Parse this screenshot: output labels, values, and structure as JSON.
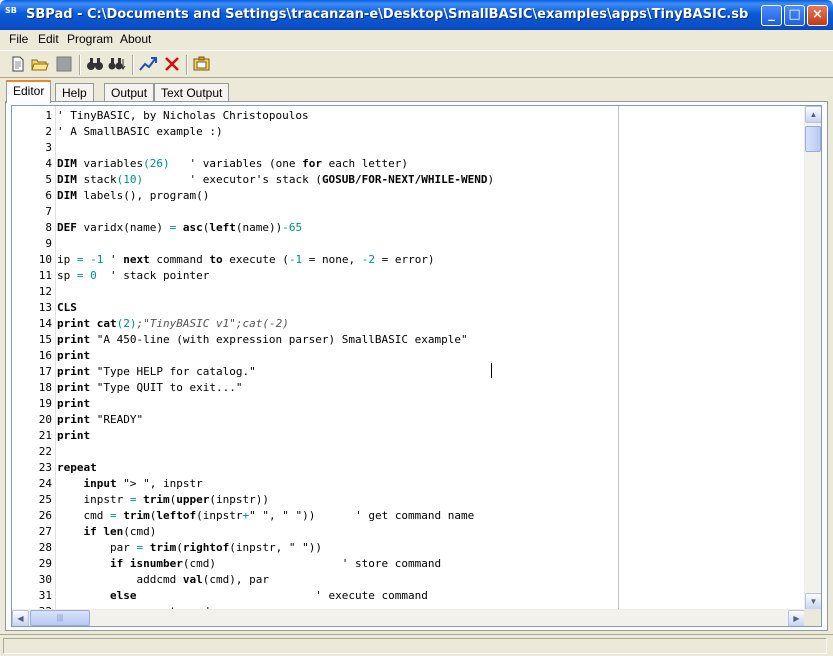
{
  "window": {
    "icon_text": "SB",
    "title": "SBPad - C:\\Documents and Settings\\tracanzan-e\\Desktop\\SmallBASIC\\examples\\apps\\TinyBASIC.sb",
    "minimize_glyph": "_",
    "maximize_glyph": "□",
    "close_glyph": "×"
  },
  "menu": [
    "File",
    "Edit",
    "Program",
    "About"
  ],
  "toolbar": {
    "icons": [
      "new-file-icon",
      "open-folder-icon",
      "save-icon",
      "find-icon",
      "find-next-icon",
      "run-icon",
      "stop-icon",
      "output-window-icon"
    ]
  },
  "tabs": [
    "Editor",
    "Help",
    "Output",
    "Text Output"
  ],
  "editor": {
    "lines": [
      {
        "n": "1",
        "seg": [
          [
            "cm",
            "' TinyBASIC, by Nicholas Christopoulos"
          ]
        ]
      },
      {
        "n": "2",
        "seg": [
          [
            "cm",
            "' A SmallBASIC example :)"
          ]
        ]
      },
      {
        "n": "3",
        "seg": []
      },
      {
        "n": "4",
        "seg": [
          [
            "kw",
            "DIM"
          ],
          [
            "",
            " variables"
          ],
          [
            "num",
            "(26)"
          ],
          [
            "",
            "   "
          ],
          [
            "cm",
            "' variables (one "
          ],
          [
            "kw",
            "for"
          ],
          [
            "cm",
            " each letter)"
          ]
        ]
      },
      {
        "n": "5",
        "seg": [
          [
            "kw",
            "DIM"
          ],
          [
            "",
            " stack"
          ],
          [
            "num",
            "(10)"
          ],
          [
            "",
            "       "
          ],
          [
            "cm",
            "' executor's stack ("
          ],
          [
            "kw",
            "GOSUB/FOR-NEXT/WHILE-WEND"
          ],
          [
            "cm",
            ")"
          ]
        ]
      },
      {
        "n": "6",
        "seg": [
          [
            "kw",
            "DIM"
          ],
          [
            "",
            " labels(), program()"
          ]
        ]
      },
      {
        "n": "7",
        "seg": []
      },
      {
        "n": "8",
        "seg": [
          [
            "kw",
            "DEF"
          ],
          [
            "",
            " varidx(name) "
          ],
          [
            "op",
            "="
          ],
          [
            "",
            " "
          ],
          [
            "kw",
            "asc"
          ],
          [
            "",
            "("
          ],
          [
            "kw",
            "left"
          ],
          [
            "",
            "(name))"
          ],
          [
            "num",
            "-65"
          ]
        ]
      },
      {
        "n": "9",
        "seg": []
      },
      {
        "n": "10",
        "seg": [
          [
            "",
            "ip "
          ],
          [
            "op",
            "="
          ],
          [
            "",
            " "
          ],
          [
            "num",
            "-1"
          ],
          [
            "",
            " "
          ],
          [
            "cm",
            "' "
          ],
          [
            "kw",
            "next"
          ],
          [
            "cm",
            " command "
          ],
          [
            "kw",
            "to"
          ],
          [
            "cm",
            " execute ("
          ],
          [
            "num",
            "-1"
          ],
          [
            "cm",
            " = none, "
          ],
          [
            "num",
            "-2"
          ],
          [
            "cm",
            " = error)"
          ]
        ]
      },
      {
        "n": "11",
        "seg": [
          [
            "",
            "sp "
          ],
          [
            "op",
            "="
          ],
          [
            "",
            " "
          ],
          [
            "num",
            "0"
          ],
          [
            "",
            "  "
          ],
          [
            "cm",
            "' stack pointer"
          ]
        ]
      },
      {
        "n": "12",
        "seg": []
      },
      {
        "n": "13",
        "seg": [
          [
            "kw",
            "CLS"
          ]
        ]
      },
      {
        "n": "14",
        "seg": [
          [
            "kw",
            "print"
          ],
          [
            "",
            " "
          ],
          [
            "kw",
            "cat"
          ],
          [
            "num",
            "(2)"
          ],
          [
            "it",
            ";\"TinyBASIC v1\";cat(-2)"
          ]
        ]
      },
      {
        "n": "15",
        "seg": [
          [
            "kw",
            "print"
          ],
          [
            "str",
            " \"A 450-line (with expression parser) SmallBASIC example\""
          ]
        ]
      },
      {
        "n": "16",
        "seg": [
          [
            "kw",
            "print"
          ]
        ]
      },
      {
        "n": "17",
        "seg": [
          [
            "kw",
            "print"
          ],
          [
            "str",
            " \"Type HELP for catalog.\""
          ]
        ]
      },
      {
        "n": "18",
        "seg": [
          [
            "kw",
            "print"
          ],
          [
            "str",
            " \"Type QUIT to exit...\""
          ]
        ]
      },
      {
        "n": "19",
        "seg": [
          [
            "kw",
            "print"
          ]
        ]
      },
      {
        "n": "20",
        "seg": [
          [
            "kw",
            "print"
          ],
          [
            "str",
            " \"READY\""
          ]
        ]
      },
      {
        "n": "21",
        "seg": [
          [
            "kw",
            "print"
          ]
        ]
      },
      {
        "n": "22",
        "seg": []
      },
      {
        "n": "23",
        "seg": [
          [
            "kw",
            "repeat"
          ]
        ]
      },
      {
        "n": "24",
        "seg": [
          [
            "",
            "    "
          ],
          [
            "kw",
            "input"
          ],
          [
            "str",
            " \"> \""
          ],
          [
            "",
            ", inpstr"
          ]
        ]
      },
      {
        "n": "25",
        "seg": [
          [
            "",
            "    inpstr "
          ],
          [
            "op",
            "="
          ],
          [
            "",
            " "
          ],
          [
            "kw",
            "trim"
          ],
          [
            "",
            "("
          ],
          [
            "kw",
            "upper"
          ],
          [
            "",
            "(inpstr))"
          ]
        ]
      },
      {
        "n": "26",
        "seg": [
          [
            "",
            "    cmd "
          ],
          [
            "op",
            "="
          ],
          [
            "",
            " "
          ],
          [
            "kw",
            "trim"
          ],
          [
            "",
            "("
          ],
          [
            "kw",
            "leftof"
          ],
          [
            "",
            "(inpstr"
          ],
          [
            "op",
            "+"
          ],
          [
            "str",
            "\" \""
          ],
          [
            "",
            ", "
          ],
          [
            "str",
            "\" \""
          ],
          [
            "",
            "))      "
          ],
          [
            "cm",
            "' get command name"
          ]
        ]
      },
      {
        "n": "27",
        "seg": [
          [
            "",
            "    "
          ],
          [
            "kw",
            "if"
          ],
          [
            "",
            " "
          ],
          [
            "kw",
            "len"
          ],
          [
            "",
            "(cmd)"
          ]
        ]
      },
      {
        "n": "28",
        "seg": [
          [
            "",
            "        par "
          ],
          [
            "op",
            "="
          ],
          [
            "",
            " "
          ],
          [
            "kw",
            "trim"
          ],
          [
            "",
            "("
          ],
          [
            "kw",
            "rightof"
          ],
          [
            "",
            "(inpstr, "
          ],
          [
            "str",
            "\" \""
          ],
          [
            "",
            "))"
          ]
        ]
      },
      {
        "n": "29",
        "seg": [
          [
            "",
            "        "
          ],
          [
            "kw",
            "if"
          ],
          [
            "",
            " "
          ],
          [
            "kw",
            "isnumber"
          ],
          [
            "",
            "(cmd)                   "
          ],
          [
            "cm",
            "' store command"
          ]
        ]
      },
      {
        "n": "30",
        "seg": [
          [
            "",
            "            addcmd "
          ],
          [
            "kw",
            "val"
          ],
          [
            "",
            "(cmd), par"
          ]
        ]
      },
      {
        "n": "31",
        "seg": [
          [
            "",
            "        "
          ],
          [
            "kw",
            "else"
          ],
          [
            "",
            "                           "
          ],
          [
            "cm",
            "' execute command"
          ]
        ]
      },
      {
        "n": "32",
        "seg": [
          [
            "",
            "            execute cmd, par"
          ]
        ]
      }
    ]
  }
}
